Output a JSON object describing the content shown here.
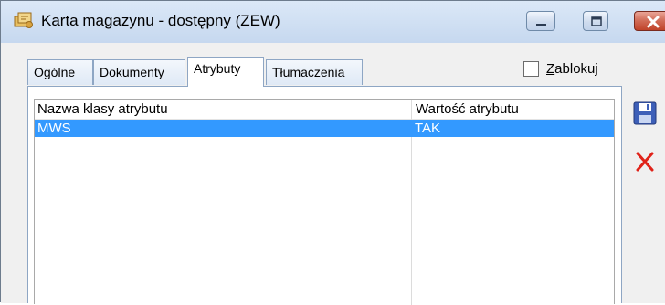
{
  "window": {
    "title": "Karta magazynu - dostępny (ZEW)"
  },
  "tabs": [
    {
      "label": "Ogólne",
      "active": false
    },
    {
      "label": "Dokumenty",
      "active": false
    },
    {
      "label": "Atrybuty",
      "active": true
    },
    {
      "label": "Tłumaczenia",
      "active": false
    }
  ],
  "lock_checkbox": {
    "label_first_letter": "Z",
    "label_rest": "ablokuj",
    "checked": false
  },
  "table": {
    "columns": [
      "Nazwa klasy atrybutu",
      "Wartość atrybutu"
    ],
    "rows": [
      {
        "name": "MWS",
        "value": "TAK",
        "selected": true
      }
    ]
  },
  "toolbar": {
    "save_icon": "save-icon",
    "delete_icon": "delete-icon"
  },
  "colors": {
    "selection": "#3399ff",
    "delete": "#e0231a"
  }
}
